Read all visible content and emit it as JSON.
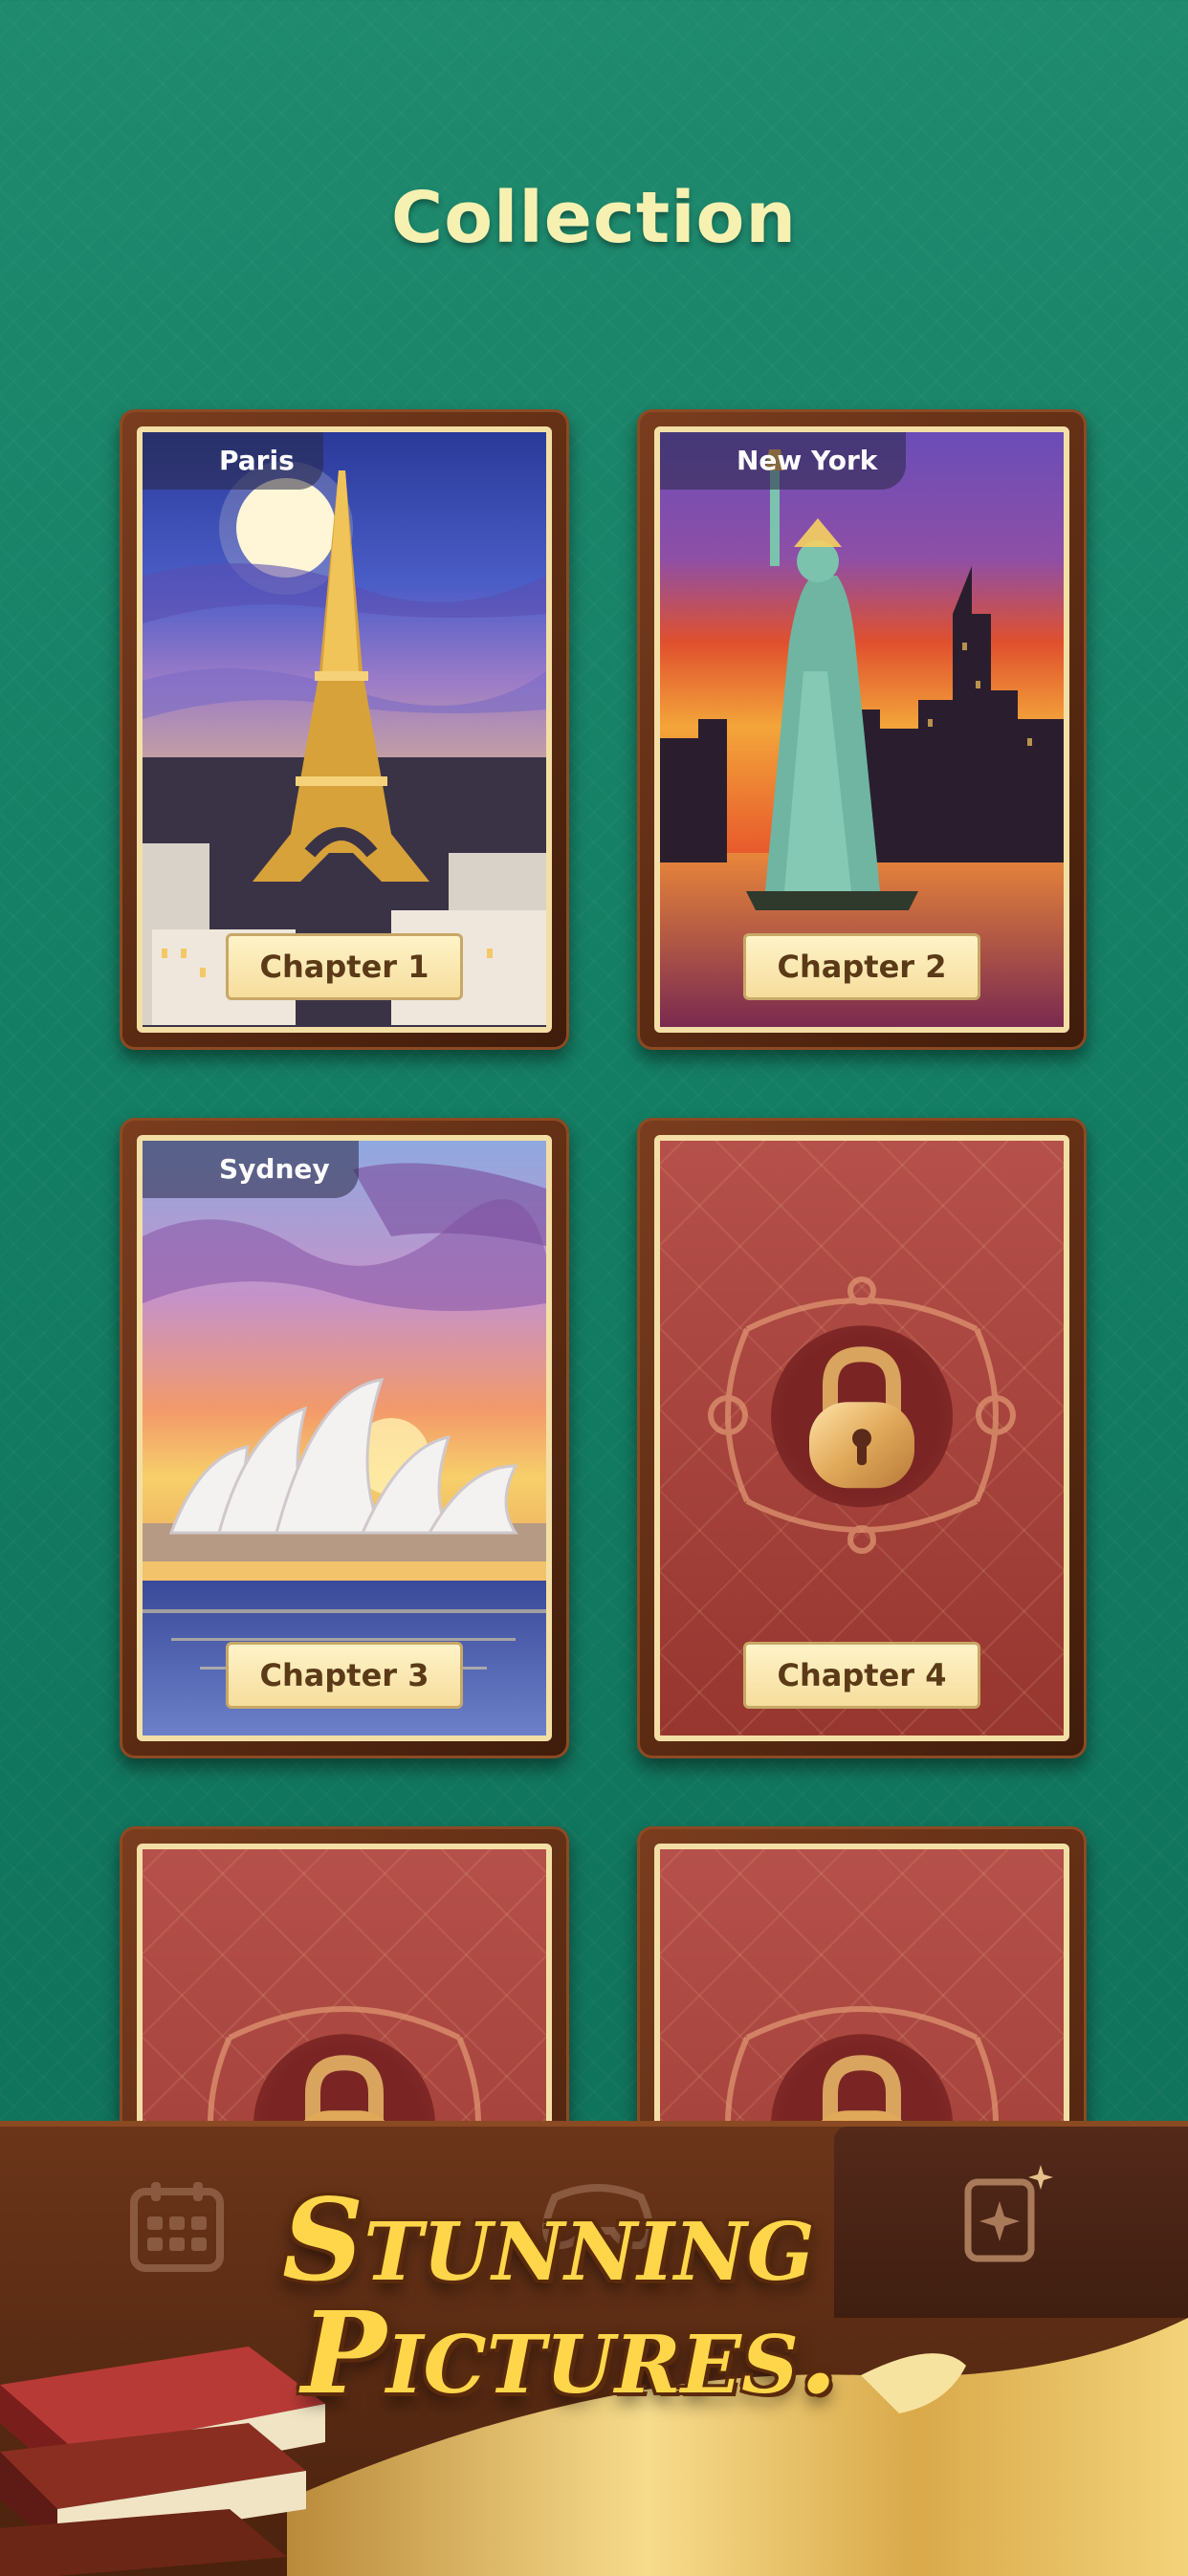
{
  "header": {
    "title": "Collection"
  },
  "cards": [
    {
      "city": "Paris",
      "chapter": "Chapter 1",
      "locked": false
    },
    {
      "city": "New York",
      "chapter": "Chapter 2",
      "locked": false
    },
    {
      "city": "Sydney",
      "chapter": "Chapter 3",
      "locked": false
    },
    {
      "city": "",
      "chapter": "Chapter 4",
      "locked": true
    },
    {
      "city": "",
      "chapter": "",
      "locked": true
    },
    {
      "city": "",
      "chapter": "",
      "locked": true
    }
  ],
  "tabbar": {
    "tabs": [
      {
        "icon": "calendar-icon",
        "active": false
      },
      {
        "icon": "gamepad-icon",
        "active": false
      },
      {
        "icon": "collection-sparkle-icon",
        "active": true
      }
    ]
  },
  "promo": {
    "line1": "Stunning",
    "line2": "Pictures."
  },
  "colors": {
    "background": "#137d63",
    "title": "#f6f1b0",
    "wood": "#5a2a12",
    "locked_card": "#a4403a",
    "gold": "#ffd64a"
  }
}
